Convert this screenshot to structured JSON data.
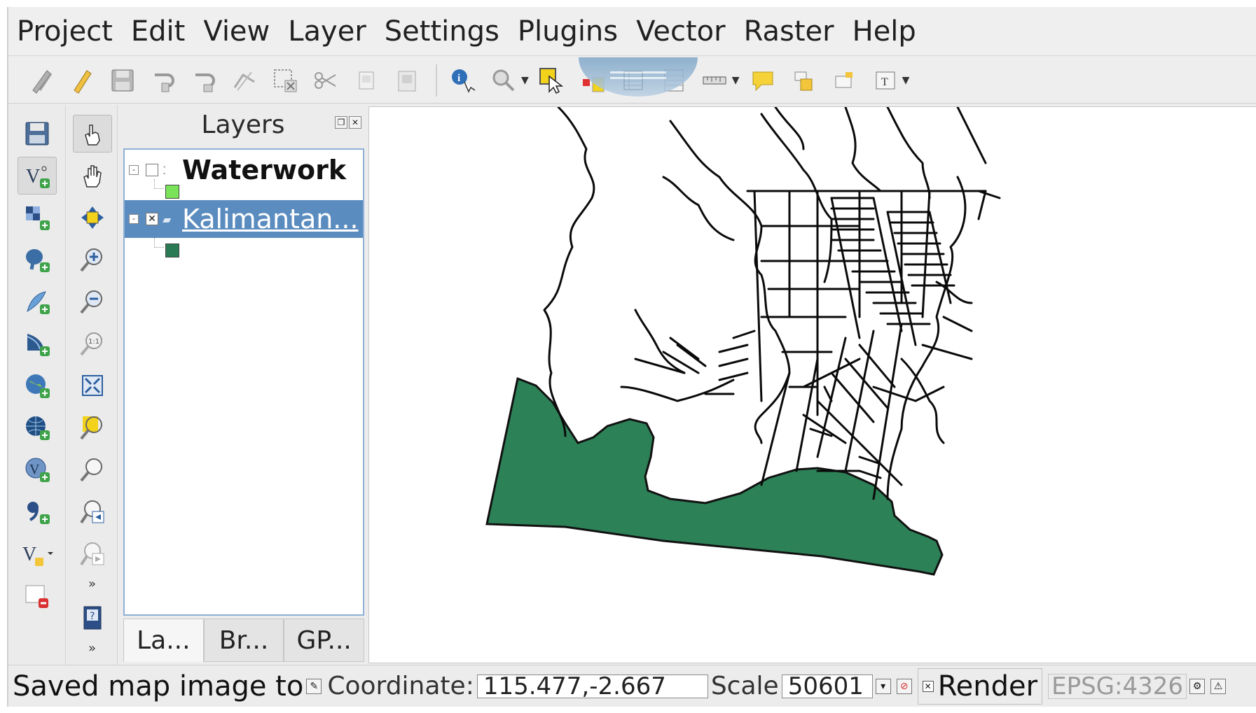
{
  "menu": {
    "items": [
      "Project",
      "Edit",
      "View",
      "Layer",
      "Settings",
      "Plugins",
      "Vector",
      "Raster",
      "Help"
    ]
  },
  "toolbar": {
    "icons": [
      "toggle-editing-icon",
      "pencil-icon",
      "save-edits-icon",
      "undo-icon",
      "redo-icon",
      "node-tool-icon",
      "delete-selected-icon",
      "cut-icon",
      "copy-icon",
      "paste-icon",
      "identify-icon",
      "zoom-select-icon",
      "select-features-icon",
      "attribute-table-icon",
      "field-calculator-icon",
      "measure-icon",
      "annotation-icon",
      "label-icon",
      "text-annotation-icon"
    ]
  },
  "layers_panel": {
    "title": "Layers",
    "layers": [
      {
        "name": "Waterwork",
        "checked": false,
        "selected": false,
        "swatch": "#7be35a"
      },
      {
        "name": "Kalimantan...",
        "checked": true,
        "selected": true,
        "swatch": "#2a7a55"
      }
    ],
    "tabs": [
      "La...",
      "Br...",
      "GP..."
    ]
  },
  "map": {
    "fill_color": "#2d8157",
    "line_color": "#0a0a0a"
  },
  "statusbar": {
    "message": "Saved map image to",
    "coordinate_label": "Coordinate:",
    "coordinate_value": "115.477,-2.667",
    "scale_label": "Scale",
    "scale_value": "50601",
    "render_label": "Render",
    "crs": "EPSG:4326"
  }
}
